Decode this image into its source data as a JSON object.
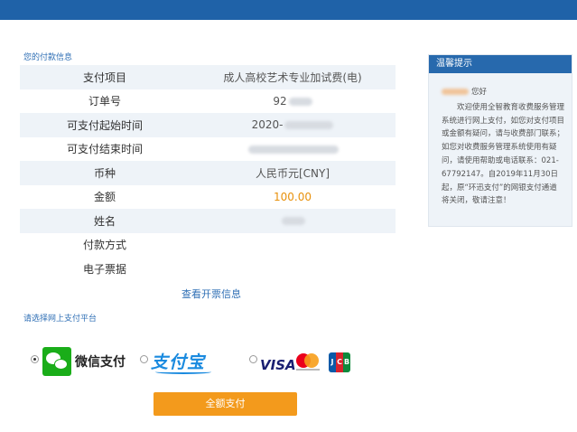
{
  "payment_info": {
    "section_title": "您的付款信息",
    "rows": [
      {
        "label": "支付项目",
        "value": "成人高校艺术专业加试费(电)"
      },
      {
        "label": "订单号",
        "value": "92"
      },
      {
        "label": "可支付起始时间",
        "value": "2020-"
      },
      {
        "label": "可支付结束时间",
        "value": ""
      },
      {
        "label": "币种",
        "value": "人民币元[CNY]"
      },
      {
        "label": "金额",
        "value": "100.00"
      },
      {
        "label": "姓名",
        "value": ""
      },
      {
        "label": "付款方式",
        "value": ""
      },
      {
        "label": "电子票据",
        "value": ""
      }
    ],
    "view_invoice": "查看开票信息"
  },
  "tips": {
    "title": "温馨提示",
    "greeting": "您好",
    "body": "欢迎使用全智教育收费服务管理系统进行网上支付，如您对支付项目或金额有疑问，请与收费部门联系；如您对收费服务管理系统使用有疑问，请使用帮助或电话联系：021-67792147。自2019年11月30日起，原“环迅支付”的网银支付通道将关闭，敬请注意！"
  },
  "platform": {
    "section_title": "请选择网上支付平台",
    "wechat_label": "微信支付",
    "alipay_label": "支付宝",
    "visa_label": "VISA",
    "jcb_letters": [
      "J",
      "C",
      "B"
    ],
    "selected": "wechat"
  },
  "pay_button_label": "全额支付",
  "colors": {
    "topbar": "#1f62a8",
    "accent_text": "#2f6fb5",
    "amount": "#e8910c",
    "pay_button": "#f39a1c",
    "wechat": "#1aad19",
    "alipay": "#1a8adf"
  }
}
